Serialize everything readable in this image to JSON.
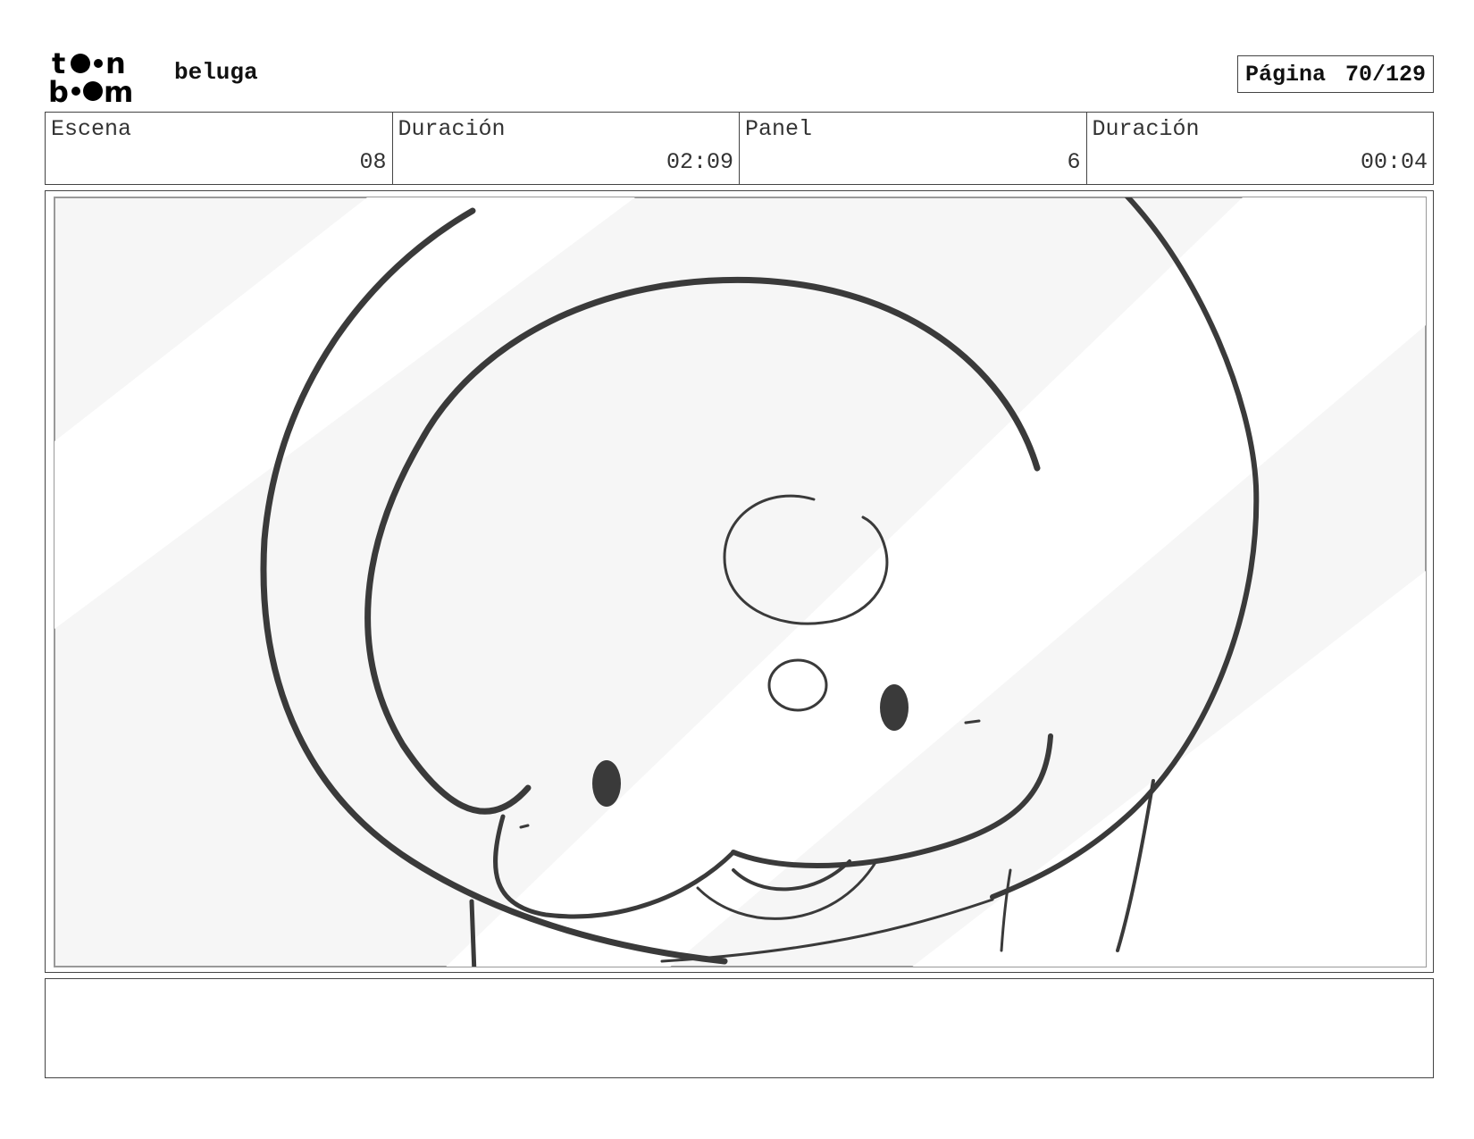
{
  "header": {
    "project_title": "beluga",
    "page_label": "Página",
    "page_value": "70/129"
  },
  "info": [
    {
      "label": "Escena",
      "value": "08"
    },
    {
      "label": "Duración",
      "value": "02:09"
    },
    {
      "label": "Panel",
      "value": "6"
    },
    {
      "label": "Duración",
      "value": "00:04"
    }
  ],
  "panel": {
    "notes": ""
  },
  "icons": {
    "logo": "toon-boom-logo"
  }
}
